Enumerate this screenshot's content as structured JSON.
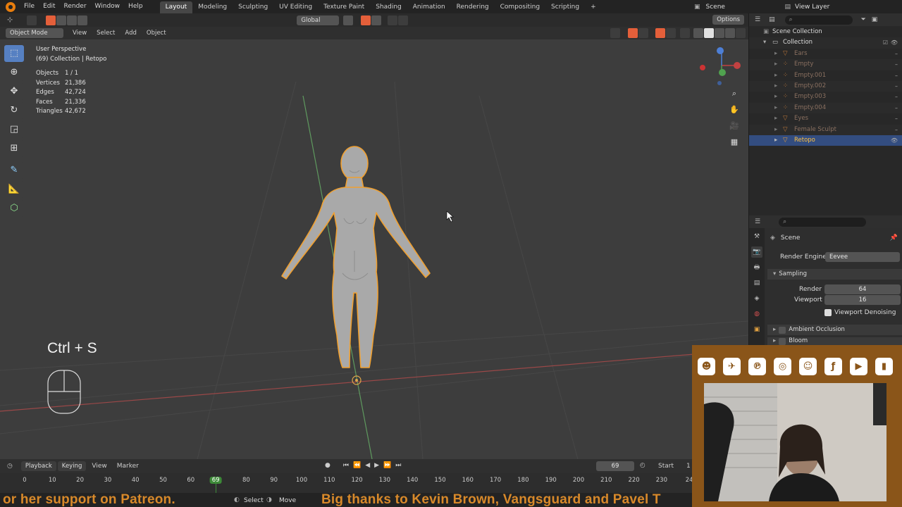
{
  "menubar": {
    "menus": [
      "File",
      "Edit",
      "Render",
      "Window",
      "Help"
    ],
    "workspaces": [
      "Layout",
      "Modeling",
      "Sculpting",
      "UV Editing",
      "Texture Paint",
      "Shading",
      "Animation",
      "Rendering",
      "Compositing",
      "Scripting"
    ],
    "add_tab": "+",
    "scene_label": "Scene",
    "view_layer_label": "View Layer"
  },
  "toolheader": {
    "orientation": "Global",
    "options": "Options"
  },
  "viewport_header": {
    "mode": "Object Mode",
    "menus": [
      "View",
      "Select",
      "Add",
      "Object"
    ]
  },
  "viewport": {
    "perspective": "User Perspective",
    "collection_info": "(69) Collection | Retopo",
    "stats": [
      {
        "k": "Objects",
        "v": "1 / 1"
      },
      {
        "k": "Vertices",
        "v": "21,386"
      },
      {
        "k": "Edges",
        "v": "42,724"
      },
      {
        "k": "Faces",
        "v": "21,336"
      },
      {
        "k": "Triangles",
        "v": "42,672"
      }
    ],
    "keycast": "Ctrl + S"
  },
  "outliner": {
    "root": "Scene Collection",
    "collection": "Collection",
    "items": [
      "Ears",
      "Empty",
      "Empty.001",
      "Empty.002",
      "Empty.003",
      "Empty.004",
      "Eyes",
      "Female Sculpt",
      "Retopo"
    ],
    "selected": "Retopo"
  },
  "properties": {
    "context": "Scene",
    "render_engine_label": "Render Engine",
    "render_engine": "Eevee",
    "sampling_panel": "Sampling",
    "render_label": "Render",
    "render_samples": "64",
    "viewport_label": "Viewport",
    "viewport_samples": "16",
    "viewport_denoising": "Viewport Denoising",
    "ambient_occlusion": "Ambient Occlusion",
    "bloom": "Bloom"
  },
  "timeline": {
    "menus": [
      "Playback",
      "Keying",
      "View",
      "Marker"
    ],
    "current_frame": "69",
    "start_label": "Start",
    "start_value": "1",
    "ticks": [
      "0",
      "10",
      "20",
      "30",
      "40",
      "50",
      "60",
      "69",
      "80",
      "90",
      "100",
      "110",
      "120",
      "130",
      "140",
      "150",
      "160",
      "170",
      "180",
      "190",
      "200",
      "210",
      "220",
      "230",
      "24"
    ]
  },
  "statusbar": {
    "select": "Select",
    "move": "Move",
    "banner_left": "or her support on Patreon.",
    "banner_right": "Big thanks to Kevin Brown, Vangsguard and Pavel T"
  },
  "colors": {
    "accent": "#e87d0d",
    "active_tool": "#5680c2",
    "selection_outline": "#f0a030",
    "social_bg": "#8a5519",
    "banner_text": "#d8892a"
  }
}
